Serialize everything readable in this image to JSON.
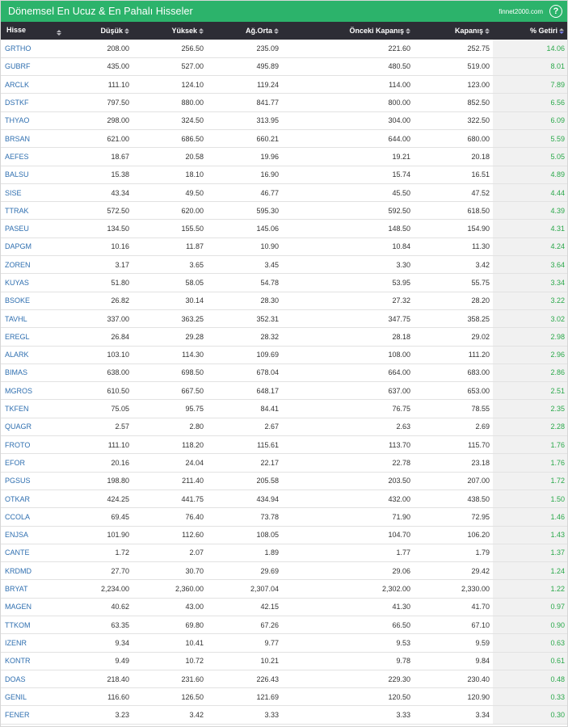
{
  "header": {
    "title": "Dönemsel En Ucuz & En Pahalı Hisseler",
    "brand": "finnet2000.com",
    "help_glyph": "?"
  },
  "colors": {
    "header_bg": "#2cb36b",
    "table_head_bg": "#2d2d35",
    "symbol_link": "#2f6fb0",
    "positive_return": "#2aa84a"
  },
  "columns": [
    "Hisse",
    "Düşük",
    "Yüksek",
    "Ağ.Orta",
    "Önceki Kapanış",
    "Kapanış",
    "% Getiri"
  ],
  "sort": {
    "column": "% Getiri",
    "direction": "desc"
  },
  "rows": [
    [
      "GRTHO",
      "208.00",
      "256.50",
      "235.09",
      "221.60",
      "252.75",
      "14.06"
    ],
    [
      "GUBRF",
      "435.00",
      "527.00",
      "495.89",
      "480.50",
      "519.00",
      "8.01"
    ],
    [
      "ARCLK",
      "111.10",
      "124.10",
      "119.24",
      "114.00",
      "123.00",
      "7.89"
    ],
    [
      "DSTKF",
      "797.50",
      "880.00",
      "841.77",
      "800.00",
      "852.50",
      "6.56"
    ],
    [
      "THYAO",
      "298.00",
      "324.50",
      "313.95",
      "304.00",
      "322.50",
      "6.09"
    ],
    [
      "BRSAN",
      "621.00",
      "686.50",
      "660.21",
      "644.00",
      "680.00",
      "5.59"
    ],
    [
      "AEFES",
      "18.67",
      "20.58",
      "19.96",
      "19.21",
      "20.18",
      "5.05"
    ],
    [
      "BALSU",
      "15.38",
      "18.10",
      "16.90",
      "15.74",
      "16.51",
      "4.89"
    ],
    [
      "SISE",
      "43.34",
      "49.50",
      "46.77",
      "45.50",
      "47.52",
      "4.44"
    ],
    [
      "TTRAK",
      "572.50",
      "620.00",
      "595.30",
      "592.50",
      "618.50",
      "4.39"
    ],
    [
      "PASEU",
      "134.50",
      "155.50",
      "145.06",
      "148.50",
      "154.90",
      "4.31"
    ],
    [
      "DAPGM",
      "10.16",
      "11.87",
      "10.90",
      "10.84",
      "11.30",
      "4.24"
    ],
    [
      "ZOREN",
      "3.17",
      "3.65",
      "3.45",
      "3.30",
      "3.42",
      "3.64"
    ],
    [
      "KUYAS",
      "51.80",
      "58.05",
      "54.78",
      "53.95",
      "55.75",
      "3.34"
    ],
    [
      "BSOKE",
      "26.82",
      "30.14",
      "28.30",
      "27.32",
      "28.20",
      "3.22"
    ],
    [
      "TAVHL",
      "337.00",
      "363.25",
      "352.31",
      "347.75",
      "358.25",
      "3.02"
    ],
    [
      "EREGL",
      "26.84",
      "29.28",
      "28.32",
      "28.18",
      "29.02",
      "2.98"
    ],
    [
      "ALARK",
      "103.10",
      "114.30",
      "109.69",
      "108.00",
      "111.20",
      "2.96"
    ],
    [
      "BIMAS",
      "638.00",
      "698.50",
      "678.04",
      "664.00",
      "683.00",
      "2.86"
    ],
    [
      "MGROS",
      "610.50",
      "667.50",
      "648.17",
      "637.00",
      "653.00",
      "2.51"
    ],
    [
      "TKFEN",
      "75.05",
      "95.75",
      "84.41",
      "76.75",
      "78.55",
      "2.35"
    ],
    [
      "QUAGR",
      "2.57",
      "2.80",
      "2.67",
      "2.63",
      "2.69",
      "2.28"
    ],
    [
      "FROTO",
      "111.10",
      "118.20",
      "115.61",
      "113.70",
      "115.70",
      "1.76"
    ],
    [
      "EFOR",
      "20.16",
      "24.04",
      "22.17",
      "22.78",
      "23.18",
      "1.76"
    ],
    [
      "PGSUS",
      "198.80",
      "211.40",
      "205.58",
      "203.50",
      "207.00",
      "1.72"
    ],
    [
      "OTKAR",
      "424.25",
      "441.75",
      "434.94",
      "432.00",
      "438.50",
      "1.50"
    ],
    [
      "CCOLA",
      "69.45",
      "76.40",
      "73.78",
      "71.90",
      "72.95",
      "1.46"
    ],
    [
      "ENJSA",
      "101.90",
      "112.60",
      "108.05",
      "104.70",
      "106.20",
      "1.43"
    ],
    [
      "CANTE",
      "1.72",
      "2.07",
      "1.89",
      "1.77",
      "1.79",
      "1.37"
    ],
    [
      "KRDMD",
      "27.70",
      "30.70",
      "29.69",
      "29.06",
      "29.42",
      "1.24"
    ],
    [
      "BRYAT",
      "2,234.00",
      "2,360.00",
      "2,307.04",
      "2,302.00",
      "2,330.00",
      "1.22"
    ],
    [
      "MAGEN",
      "40.62",
      "43.00",
      "42.15",
      "41.30",
      "41.70",
      "0.97"
    ],
    [
      "TTKOM",
      "63.35",
      "69.80",
      "67.26",
      "66.50",
      "67.10",
      "0.90"
    ],
    [
      "IZENR",
      "9.34",
      "10.41",
      "9.77",
      "9.53",
      "9.59",
      "0.63"
    ],
    [
      "KONTR",
      "9.49",
      "10.72",
      "10.21",
      "9.78",
      "9.84",
      "0.61"
    ],
    [
      "DOAS",
      "218.40",
      "231.60",
      "226.43",
      "229.30",
      "230.40",
      "0.48"
    ],
    [
      "GENIL",
      "116.60",
      "126.50",
      "121.69",
      "120.50",
      "120.90",
      "0.33"
    ],
    [
      "FENER",
      "3.23",
      "3.42",
      "3.33",
      "3.33",
      "3.34",
      "0.30"
    ]
  ]
}
